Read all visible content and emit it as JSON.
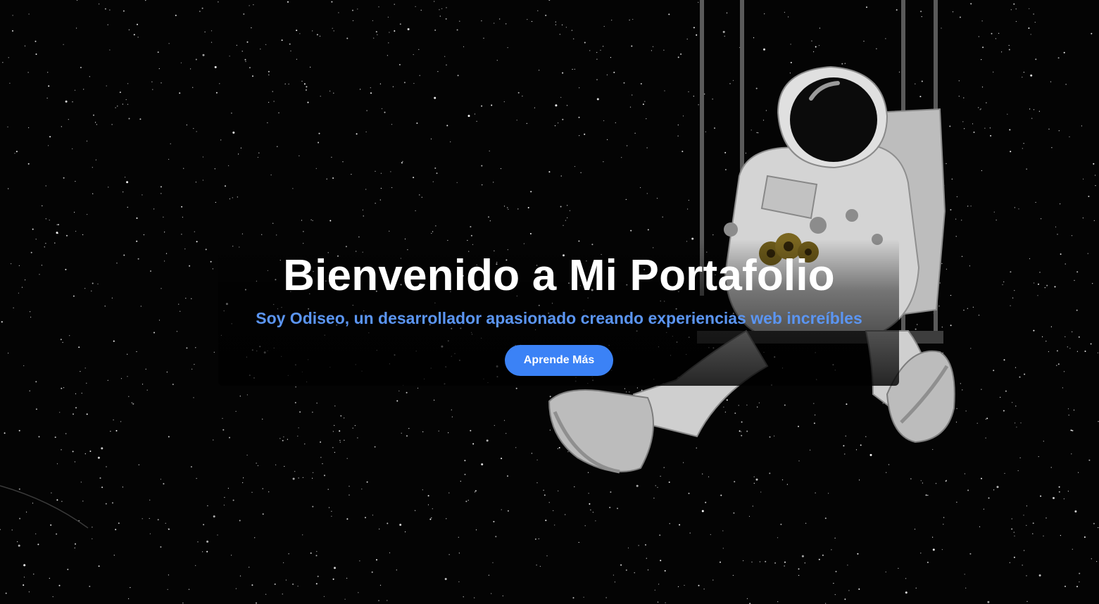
{
  "hero": {
    "title": "Bienvenido a Mi Portafolio",
    "subtitle": "Soy Odiseo, un desarrollador apasionado creando experiencias web increíbles",
    "cta_label": "Aprende Más"
  },
  "colors": {
    "background": "#040404",
    "title": "#ffffff",
    "subtitle": "#5b95f2",
    "button": "#3b82f6"
  },
  "illustration": {
    "icon": "astronaut-on-swing-illustration"
  }
}
